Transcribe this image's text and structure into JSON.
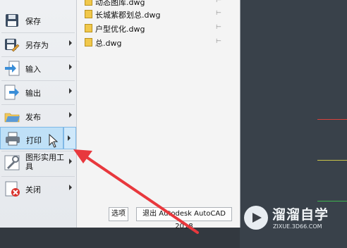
{
  "menu": {
    "items": [
      {
        "label": "保存",
        "icon": "floppy-disk-icon",
        "has_submenu": false
      },
      {
        "label": "另存为",
        "icon": "save-as-icon",
        "has_submenu": true
      },
      {
        "label": "输入",
        "icon": "import-icon",
        "has_submenu": true
      },
      {
        "label": "输出",
        "icon": "export-icon",
        "has_submenu": true
      },
      {
        "label": "发布",
        "icon": "publish-icon",
        "has_submenu": true
      },
      {
        "label": "打印",
        "icon": "printer-icon",
        "has_submenu": true,
        "selected": true
      },
      {
        "label": "图形实用工具",
        "label_lines": [
          "图形实用工",
          "具"
        ],
        "icon": "drawing-utilities-icon",
        "has_submenu": true
      },
      {
        "label": "关闭",
        "icon": "close-drawing-icon",
        "has_submenu": true
      }
    ]
  },
  "recent_documents": [
    {
      "name": "动态图库.dwg"
    },
    {
      "name": "长城紫郡划总.dwg"
    },
    {
      "name": "户型优化.dwg"
    },
    {
      "name": "总.dwg"
    }
  ],
  "buttons": {
    "options": "选项",
    "exit": "退出 Autodesk AutoCAD 2018"
  },
  "watermark": {
    "title": "溜溜自学",
    "url": "ZIXUE.3D66.COM"
  },
  "colors": {
    "annotation_arrow": "#e8383d",
    "selected_item": "#bfe0f7",
    "canvas_background": "#39414a",
    "canvas_line_red": "#d9413b",
    "canvas_line_yellow": "#c9c24a",
    "canvas_line_green": "#3fb34f"
  }
}
